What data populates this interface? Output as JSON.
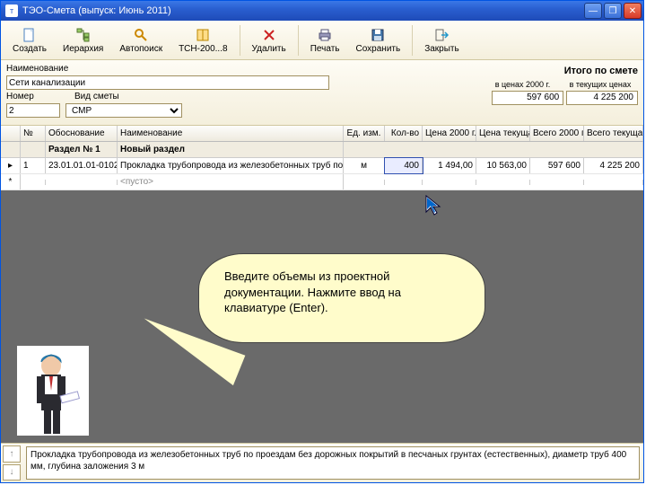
{
  "title": "ТЭО-Смета  (выпуск: Июнь 2011)",
  "toolbar": {
    "create": "Создать",
    "hierarchy": "Иерархия",
    "autosearch": "Автопоиск",
    "tsn": "ТСН-200...8",
    "delete": "Удалить",
    "print": "Печать",
    "save": "Сохранить",
    "close": "Закрыть"
  },
  "form": {
    "name_lbl": "Наименование",
    "name_val": "Сети канализации",
    "num_lbl": "Номер",
    "num_val": "2",
    "type_lbl": "Вид сметы",
    "type_val": "СМР",
    "total_lbl": "Итого по смете",
    "p2000_lbl": "в ценах 2000 г.",
    "pcur_lbl": "в текущих ценах",
    "p2000_val": "597 600",
    "pcur_val": "4 225 200"
  },
  "grid": {
    "head": [
      "",
      "№",
      "Обоснование",
      "Наименование",
      "Ед. изм.",
      "Кол-во",
      "Цена 2000 г.",
      "Цена текущая",
      "Всего 2000 г.",
      "Всего текущая"
    ],
    "section_label": "Раздел № 1",
    "section_name": "Новый раздел",
    "row1": {
      "num": "1",
      "code": "23.01.01.01-0102",
      "name": "Прокладка трубопровода из железобетонных труб по проездам без до…",
      "unit": "м",
      "qty": "400",
      "p2000": "1 494,00",
      "pcur": "10 563,00",
      "t2000": "597 600",
      "tcur": "4 225 200"
    },
    "row_empty": "<пусто>"
  },
  "callout": "Введите объемы из проектной документации. Нажмите ввод на клавиатуре (Enter).",
  "footer_desc": "Прокладка трубопровода из железобетонных труб по проездам без дорожных покрытий в песчаных грунтах (естественных), диаметр труб 400 мм, глубина заложения 3 м"
}
